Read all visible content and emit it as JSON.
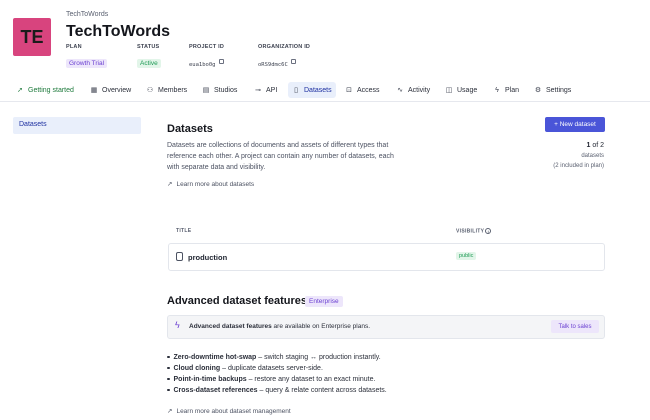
{
  "header": {
    "avatar_initials": "TE",
    "org_name": "TechToWords",
    "project_title": "TechToWords",
    "plan_label": "PLAN",
    "plan_value": "Growth Trial",
    "status_label": "STATUS",
    "status_value": "Active",
    "project_id_label": "PROJECT ID",
    "project_id_value": "eua1bo0g",
    "organization_id_label": "ORGANIZATION ID",
    "organization_id_value": "oRS9dmc6C"
  },
  "tabs": [
    {
      "label": "Getting started",
      "icon": "rocket-icon"
    },
    {
      "label": "Overview",
      "icon": "grid-icon"
    },
    {
      "label": "Members",
      "icon": "users-icon"
    },
    {
      "label": "Studios",
      "icon": "layout-icon"
    },
    {
      "label": "API",
      "icon": "plug-icon"
    },
    {
      "label": "Datasets",
      "icon": "database-icon"
    },
    {
      "label": "Access",
      "icon": "lock-icon"
    },
    {
      "label": "Activity",
      "icon": "activity-icon"
    },
    {
      "label": "Usage",
      "icon": "chart-icon"
    },
    {
      "label": "Plan",
      "icon": "bolt-icon"
    },
    {
      "label": "Settings",
      "icon": "gear-icon"
    }
  ],
  "sidebar": {
    "items": [
      {
        "label": "Datasets"
      }
    ]
  },
  "main": {
    "title": "Datasets",
    "description": "Datasets are collections of documents and assets of different types that reference each other. A project can contain any number of datasets, each with separate data and visibility.",
    "learn_more": "Learn more about datasets",
    "new_button": "+ New dataset",
    "count_current": "1",
    "count_of": " of 2",
    "count_label": "datasets",
    "count_plan": "(2 included in plan)",
    "table": {
      "col_title": "TITLE",
      "col_visibility": "VISIBILITY",
      "rows": [
        {
          "title": "production",
          "visibility": "public"
        }
      ]
    }
  },
  "advanced": {
    "title": "Advanced dataset features",
    "badge": "Enterprise",
    "banner_bold": "Advanced dataset features",
    "banner_rest": " are available on Enterprise plans.",
    "talk_button": "Talk to sales",
    "features": [
      {
        "name": "Zero-downtime hot-swap",
        "desc": " – switch staging ↔ production instantly."
      },
      {
        "name": "Cloud cloning",
        "desc": " – duplicate datasets server-side."
      },
      {
        "name": "Point-in-time backups",
        "desc": " – restore any dataset to an exact minute."
      },
      {
        "name": "Cross-dataset references",
        "desc": " – query & relate content across datasets."
      }
    ],
    "learn_more": "Learn more about dataset management"
  },
  "colors": {
    "accent": "#4a55d8",
    "avatar": "#d8447e",
    "success": "#1e9a55",
    "enterprise": "#6a3fd1"
  }
}
